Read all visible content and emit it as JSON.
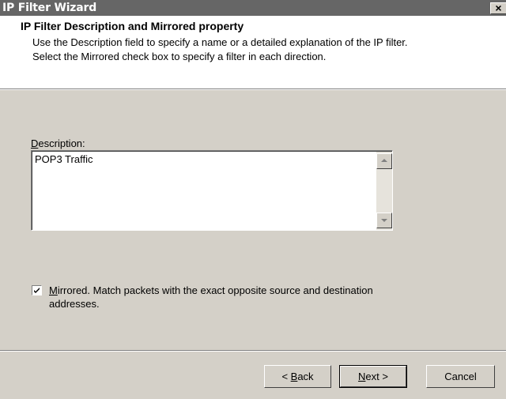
{
  "window": {
    "title": "IP Filter Wizard",
    "close_glyph": "×"
  },
  "header": {
    "title": "IP Filter Description and Mirrored property",
    "line1": "Use the Description field to specify a name or a detailed explanation of the IP filter.",
    "line2": "Select the Mirrored check box to specify a filter in each direction."
  },
  "description": {
    "label_hotkey": "D",
    "label_rest": "escription:",
    "value": "POP3 Traffic"
  },
  "mirrored": {
    "checked": true,
    "hotkey": "M",
    "line1_rest": "irrored. Match packets with the exact opposite source and destination",
    "line2": "addresses."
  },
  "buttons": {
    "back_prefix": "< ",
    "back_hotkey": "B",
    "back_rest": "ack",
    "next_hotkey": "N",
    "next_rest": "ext >",
    "cancel": "Cancel"
  },
  "icons": {
    "close": "close-icon",
    "scroll_up": "scroll-up-arrow-icon",
    "scroll_down": "scroll-down-arrow-icon",
    "check": "checkmark-icon"
  }
}
